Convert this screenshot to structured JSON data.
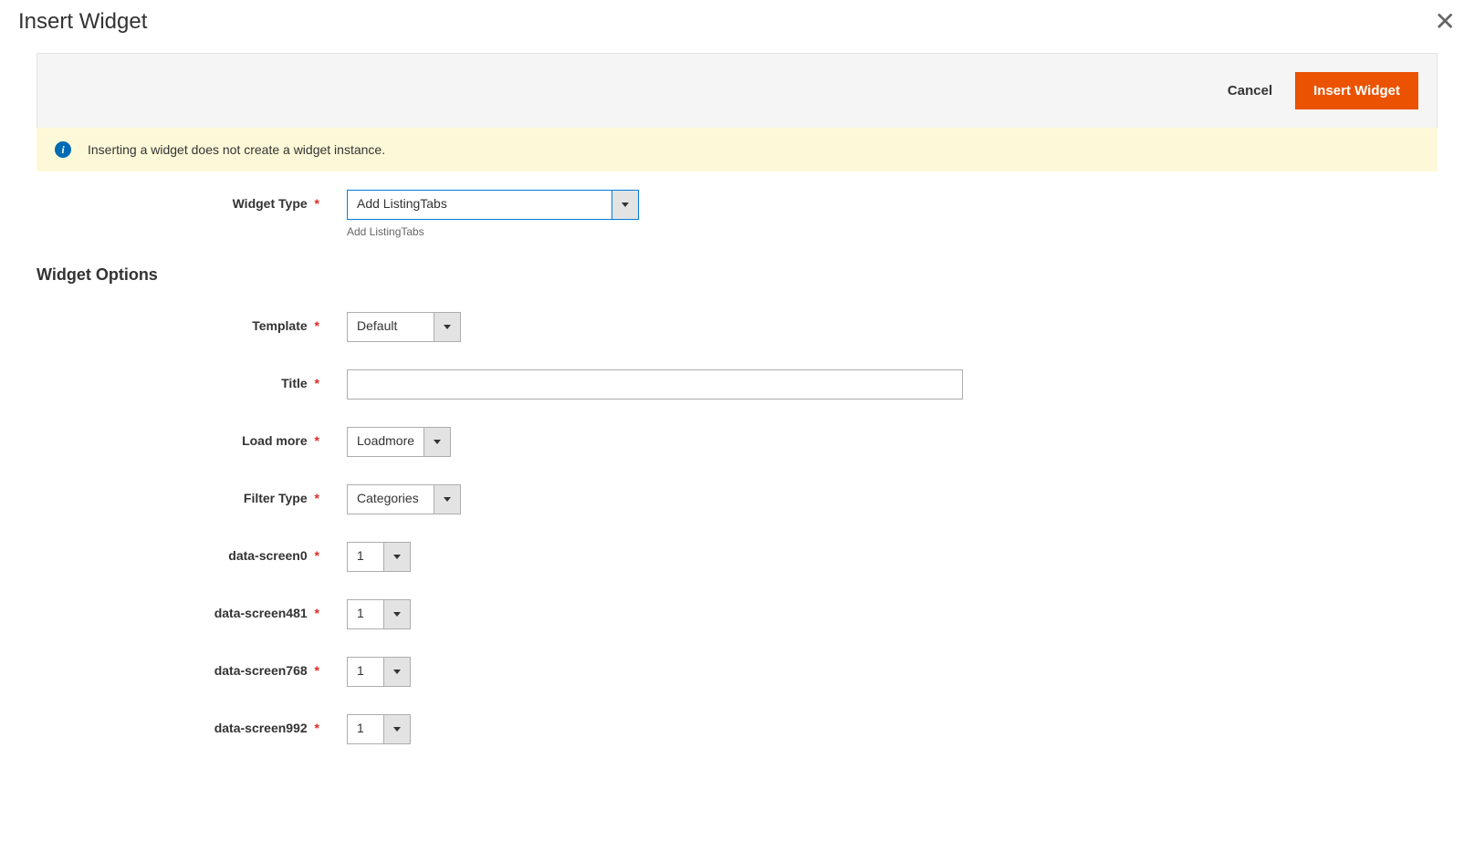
{
  "modal": {
    "title": "Insert Widget",
    "close_label": "✕"
  },
  "toolbar": {
    "cancel_label": "Cancel",
    "insert_label": "Insert Widget"
  },
  "info_banner": {
    "icon_char": "i",
    "text": "Inserting a widget does not create a widget instance."
  },
  "fields": {
    "widget_type": {
      "label": "Widget Type",
      "value": "Add ListingTabs",
      "helper": "Add ListingTabs"
    },
    "section_title": "Widget Options",
    "template": {
      "label": "Template",
      "value": "Default"
    },
    "title": {
      "label": "Title",
      "value": ""
    },
    "load_more": {
      "label": "Load more",
      "value": "Loadmore"
    },
    "filter_type": {
      "label": "Filter Type",
      "value": "Categories"
    },
    "data_screen0": {
      "label": "data-screen0",
      "value": "1"
    },
    "data_screen481": {
      "label": "data-screen481",
      "value": "1"
    },
    "data_screen768": {
      "label": "data-screen768",
      "value": "1"
    },
    "data_screen992": {
      "label": "data-screen992",
      "value": "1"
    }
  }
}
